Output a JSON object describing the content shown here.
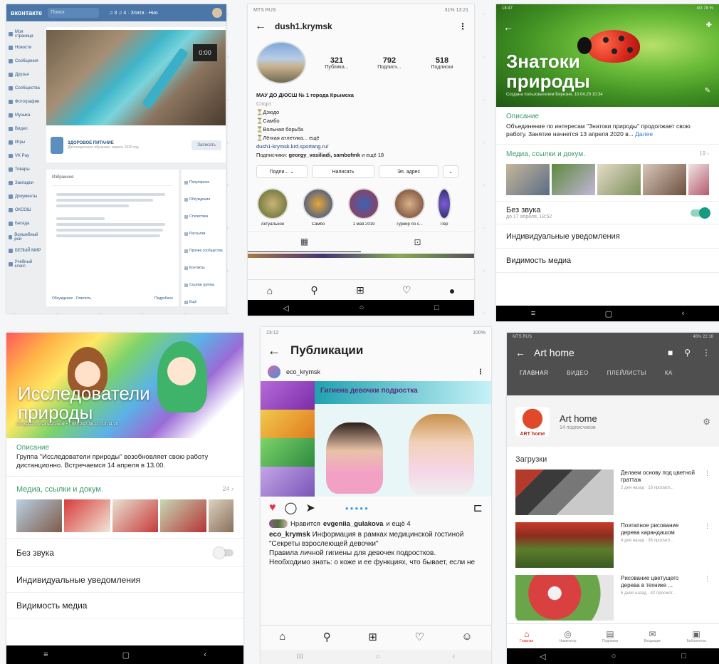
{
  "panel1": {
    "logo": "вконтакте",
    "search_placeholder": "Поиск",
    "top_info": "♫ 3 ♫ 4 · Злата · Нио",
    "post_title": "ЗДОРОВОЕ ПИТАНИЕ",
    "post_sub": "Дистанционное обучение, апрель 2020 год",
    "post_button": "Записать",
    "nav_items": [
      "Моя страница",
      "Новости",
      "Сообщения",
      "Друзья",
      "Сообщества",
      "Фотографии",
      "Музыка",
      "Видео",
      "Игры",
      "VK Pay",
      "Товары",
      "Закладки",
      "Документы",
      "ОКСОШ",
      "Беседа",
      "Волшебный рой",
      "БЕЛЫЙ МИР",
      "Учебный класс"
    ],
    "card_header": "Избранное",
    "card_footer_left": "Обсуждение · Ответить",
    "card_footer_right": "Подробнее",
    "right_items": [
      "Популярное",
      "Обсуждения",
      "Статистика",
      "Рассылки",
      "Прочие сообщества",
      "Контакты",
      "Ссылки группы",
      "Ещё"
    ]
  },
  "panel2": {
    "status_left": "MTS RUS",
    "status_right": "31% 13:21",
    "username": "dush1.krymsk",
    "stats": [
      {
        "n": "321",
        "l": "Публика..."
      },
      {
        "n": "792",
        "l": "Подписч..."
      },
      {
        "n": "518",
        "l": "Подписки"
      }
    ],
    "bio_name": "МАУ ДО ДЮСШ № 1 города Крымска",
    "bio_category": "Спорт",
    "bio_lines": [
      "⏳Дзюдо",
      "⏳Самбо",
      "⏳Вольная борьба",
      "⏳Лёгкая атлетика... ещё"
    ],
    "bio_link": "dush1-krymsk.krd.sportang.ru/",
    "mutual_prefix": "Подписчики:",
    "mutual_names": "georgy_vasiliadi, sambofmk",
    "mutual_suffix": "и ещё 18",
    "buttons": [
      "Подпи... ⌄",
      "Написать",
      "Эл. адрес",
      "⌄"
    ],
    "highlights": [
      "Актуальное",
      "Самбо",
      "1 мая 2019",
      "Турнир по с...",
      "Пер"
    ]
  },
  "panel3": {
    "status_left": "18:47",
    "status_right": "4G 78 %",
    "title_line1": "Знатоки",
    "title_line2": "природы",
    "created": "Создана пользователем Березня, 10.04.20 10:34",
    "desc_label": "Описание",
    "description": "Объединение по интересам \"Знатоки природы\" продолжает свою работу. Занятие начнется 13 апреля 2020 в...",
    "more": "Далее",
    "media_label": "Медиа, ссылки и докум.",
    "media_count": "19 ›",
    "mute_label": "Без звука",
    "mute_sub": "до 17 апреля, 18:52",
    "mute_on": true,
    "notif_label": "Индивидуальные уведомления",
    "visibility_label": "Видимость медиа",
    "sys": [
      "≡",
      "▢",
      "‹"
    ]
  },
  "panel4": {
    "title_line1": "Исследователи",
    "title_line2": "природы",
    "created": "Создана пользователем +7 988 247-38-11, 13.04.20",
    "desc_label": "Описание",
    "description": "Группа \"Исследователи природы\" возобновляет свою работу дистанционно. Встречаемся 14 апреля в 13.00.",
    "media_label": "Медиа, ссылки и докум.",
    "media_count": "24 ›",
    "mute_label": "Без звука",
    "mute_on": false,
    "notif_label": "Индивидуальные уведомления",
    "visibility_label": "Видимость медиа",
    "sys": [
      "≡",
      "▢",
      "‹"
    ]
  },
  "panel5": {
    "status_left": "23:12",
    "status_right": "100%",
    "title": "Публикации",
    "author": "eco_krymsk",
    "banner": "Гигиена девочки подростка",
    "likes_prefix": "Нравится",
    "likes_user": "evgeniia_gulakova",
    "likes_suffix": "и ещё 4",
    "caption_user": "eco_krymsk",
    "caption_text": "Информация в рамках медицинской гостиной \"Секреты взрослеющей девочки\"",
    "caption_p2": "Правила личной гигиены для девочек подростков.",
    "caption_p3": "Необходимо знать: о коже и ее функциях, что бывает, если не",
    "sys": [
      "III",
      "○",
      "‹"
    ]
  },
  "panel6": {
    "status_left": "MTS RUS",
    "status_right": "48% 22:16",
    "title": "Art home",
    "tabs": [
      "ГЛАВНАЯ",
      "ВИДЕО",
      "ПЛЕЙЛИСТЫ",
      "КА"
    ],
    "channel_name": "Art home",
    "subscribers": "14 подписчиков",
    "channel_logo": "ART home",
    "uploads_label": "Загрузки",
    "videos": [
      {
        "title": "Делаем основу под цветной граттаж",
        "meta": "2 дня назад · 18 просмот..."
      },
      {
        "title": "Поэтапное рисование дерева карандашом",
        "meta": "4 дня назад · 36 просмот..."
      },
      {
        "title": "Рисование цветущего дерева в технике ...",
        "meta": "5 дней назад · 42 просмот..."
      }
    ],
    "bottom_nav": [
      "Главная",
      "Навигатор",
      "Подписки",
      "Входящие",
      "Библиотека"
    ],
    "sys": [
      "◁",
      "○",
      "□"
    ]
  }
}
